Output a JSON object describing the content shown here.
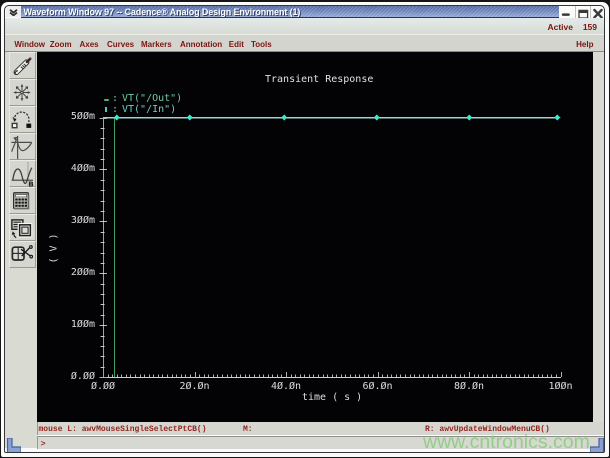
{
  "window": {
    "title": "Waveform Window 97 -- Cadence® Analog Design Environment (1)",
    "controls": {
      "shade": "window-shade-chevron",
      "minimize": "minimize",
      "maximize": "maximize",
      "close": "close"
    }
  },
  "banner": {
    "active_label": "Active",
    "active_value": "159"
  },
  "menu": {
    "items": [
      {
        "label": "Window"
      },
      {
        "label": "Zoom"
      },
      {
        "label": "Axes"
      },
      {
        "label": "Curves"
      },
      {
        "label": "Markers"
      },
      {
        "label": "Annotation"
      },
      {
        "label": "Edit"
      },
      {
        "label": "Tools"
      }
    ],
    "help_label": "Help"
  },
  "toolbar": {
    "buttons": [
      {
        "name": "pen-tool"
      },
      {
        "name": "fit-all-starburst"
      },
      {
        "name": "swap-axes-arc"
      },
      {
        "name": "strip-chart-axes"
      },
      {
        "name": "waveform-b-calculator-plot"
      },
      {
        "name": "calculator"
      },
      {
        "name": "subwindow-copy"
      },
      {
        "name": "delete-subwindow-scissors"
      }
    ]
  },
  "plot": {
    "title": "Transient Response",
    "legend": [
      {
        "marker": "dash",
        "colon": ":",
        "label": "VT(\"/Out\")",
        "color": "#6cc9a4"
      },
      {
        "marker": "vbar",
        "colon": ":",
        "label": "VT(\"/In\")",
        "color": "#6fcfca"
      }
    ],
    "xlabel": "time ( s )",
    "ylabel": "( V )"
  },
  "chart_data": {
    "type": "line",
    "title": "Transient Response",
    "xlabel": "time ( s )",
    "ylabel": "( V )",
    "x_tick_labels": [
      "0.00",
      "20.0n",
      "40.0n",
      "60.0n",
      "80.0n",
      "100n"
    ],
    "y_tick_labels": [
      "0.00",
      "100m",
      "200m",
      "300m",
      "400m",
      "500m"
    ],
    "xlim_ns": [
      0,
      100
    ],
    "ylim_mv": [
      0,
      500
    ],
    "x_minor_step_ns": 1,
    "x_major_step_ns": 20,
    "y_minor_step_mv": 20,
    "y_major_step_mv": 100,
    "series": [
      {
        "name": "VT(\"/Out\")",
        "color": "#3f9f63",
        "points_ns_mv": [
          [
            2.5,
            0
          ],
          [
            2.5,
            500
          ],
          [
            100,
            500
          ]
        ]
      },
      {
        "name": "VT(\"/In\")",
        "color_v": "#55c4c2",
        "color_h": "#98d6d1",
        "points_ns_mv": [
          [
            0,
            0
          ],
          [
            0,
            500
          ],
          [
            99.3,
            500
          ]
        ],
        "marker": "diamond",
        "marker_color": "#3de8cf",
        "markers_ns": [
          3,
          19,
          39.6,
          59.8,
          80,
          99.3
        ]
      }
    ]
  },
  "status": {
    "left": "mouse L: awvMouseSingleSelectPtCB()",
    "middle": "M:",
    "right": "R: awvUpdateWindowMenuCB()"
  },
  "prompt": ">",
  "watermark": "www.cntronics.com"
}
